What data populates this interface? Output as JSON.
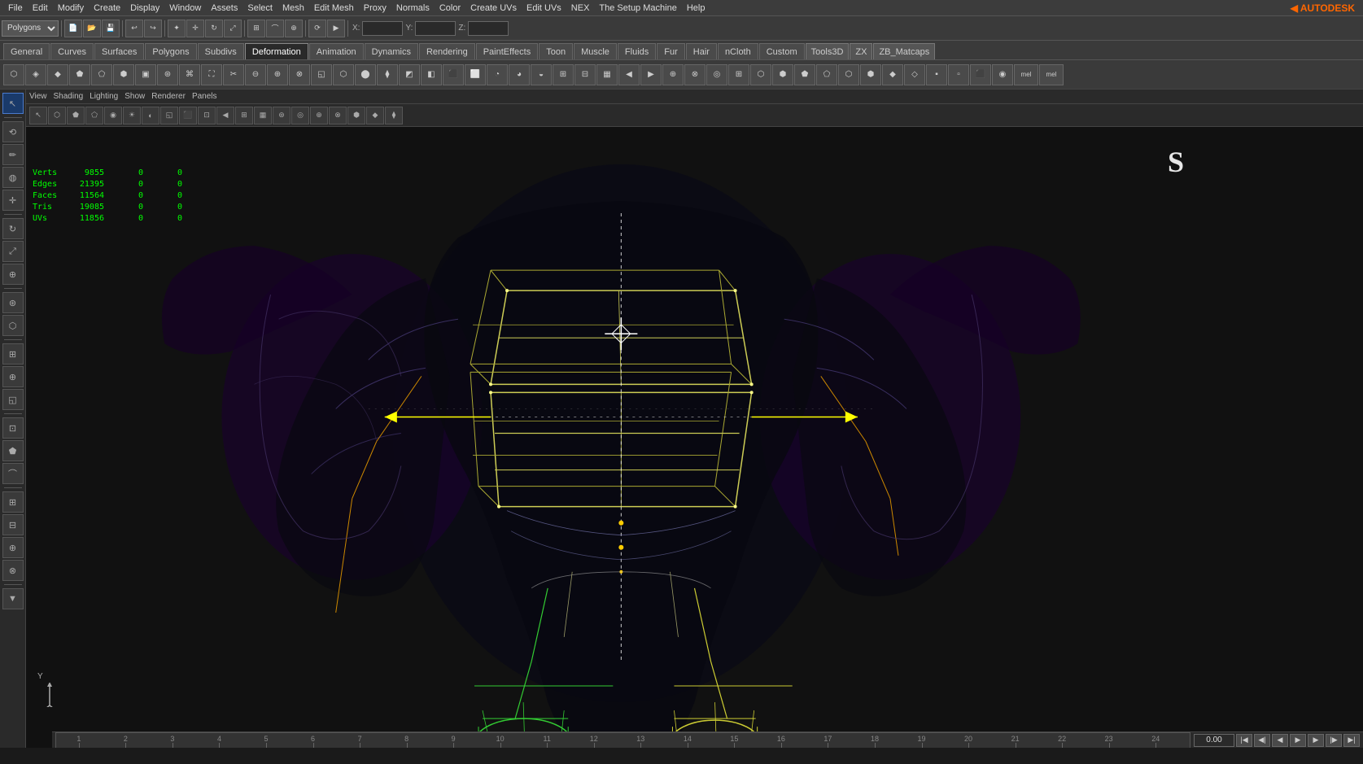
{
  "app": {
    "title": "Autodesk Maya"
  },
  "menu": {
    "items": [
      "File",
      "Edit",
      "Modify",
      "Create",
      "Display",
      "Window",
      "Assets",
      "Select",
      "Mesh",
      "Edit Mesh",
      "Proxy",
      "Normals",
      "Color",
      "Create UVs",
      "Edit UVs",
      "NEX",
      "The Setup Machine",
      "Help"
    ]
  },
  "toolbar1": {
    "mode_select": "Polygons",
    "coord_x_label": "X:",
    "coord_y_label": "Y:",
    "coord_z_label": "Z:"
  },
  "tabs": {
    "items": [
      "General",
      "Curves",
      "Surfaces",
      "Polygons",
      "Subdivs",
      "Deformation",
      "Animation",
      "Dynamics",
      "Rendering",
      "PaintEffects",
      "Toon",
      "Muscle",
      "Fluids",
      "Fur",
      "Hair",
      "nCloth",
      "Custom",
      "Tools3D",
      "ZX",
      "ZB_Matcaps"
    ]
  },
  "viewport": {
    "menu_items": [
      "View",
      "Shading",
      "Lighting",
      "Show",
      "Renderer",
      "Panels"
    ],
    "stats": [
      {
        "label": "Verts",
        "value": "9855",
        "col1": "0",
        "col2": "0"
      },
      {
        "label": "Edges",
        "value": "21395",
        "col1": "0",
        "col2": "0"
      },
      {
        "label": "Faces",
        "value": "11564",
        "col1": "0",
        "col2": "0"
      },
      {
        "label": "Tris",
        "value": "19085",
        "col1": "0",
        "col2": "0"
      },
      {
        "label": "UVs",
        "value": "11856",
        "col1": "0",
        "col2": "0"
      }
    ]
  },
  "timeline": {
    "start": 1,
    "end": 24,
    "ticks": [
      1,
      2,
      3,
      4,
      5,
      6,
      7,
      8,
      9,
      10,
      11,
      12,
      13,
      14,
      15,
      16,
      17,
      18,
      19,
      20,
      21,
      22,
      23,
      24
    ],
    "current_time": "0.00",
    "controls": [
      "<<",
      "<|",
      "<",
      "▶",
      ">",
      "|>",
      ">>"
    ]
  },
  "axis": {
    "label": "Y"
  },
  "colors": {
    "bg": "#111111",
    "toolbar_bg": "#3a3a3a",
    "tab_active_bg": "#2a2a2a",
    "accent": "#2255aa",
    "stats_color": "#00ff00",
    "wireframe_yellow": "#cccc00",
    "wireframe_green": "#00cc00",
    "wireframe_white": "#ffffff"
  }
}
